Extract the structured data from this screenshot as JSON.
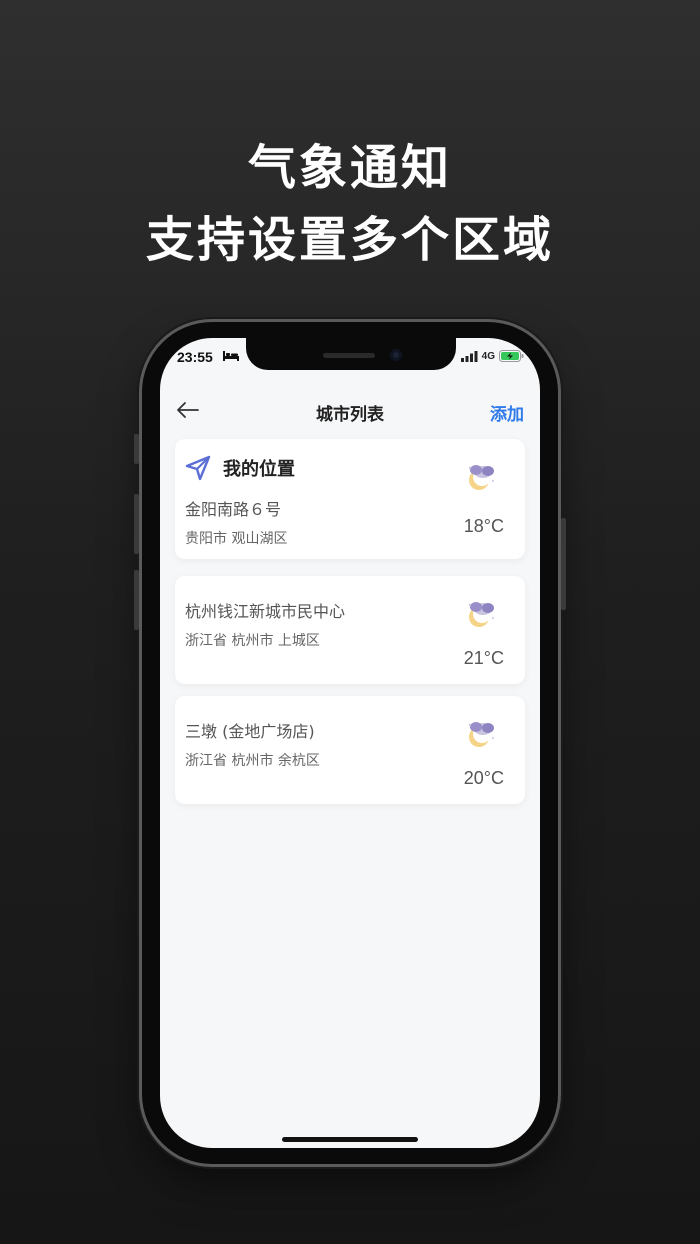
{
  "headline": {
    "line1": "气象通知",
    "line2": "支持设置多个区域"
  },
  "status_bar": {
    "time": "23:55",
    "network": "4G"
  },
  "nav": {
    "title": "城市列表",
    "add_label": "添加"
  },
  "cities": [
    {
      "title": "我的位置",
      "address": "金阳南路６号",
      "region": "贵阳市 观山湖区",
      "temp": "18°C",
      "icon": "partly-cloudy-night-icon"
    },
    {
      "address": "杭州钱江新城市民中心",
      "region": "浙江省 杭州市 上城区",
      "temp": "21°C",
      "icon": "partly-cloudy-night-icon"
    },
    {
      "address": "三墩 (金地广场店)",
      "region": "浙江省 杭州市 余杭区",
      "temp": "20°C",
      "icon": "partly-cloudy-night-icon"
    }
  ],
  "colors": {
    "accent": "#2f7bea",
    "location_icon": "#5b6fd6",
    "background": "#f6f7f8"
  }
}
